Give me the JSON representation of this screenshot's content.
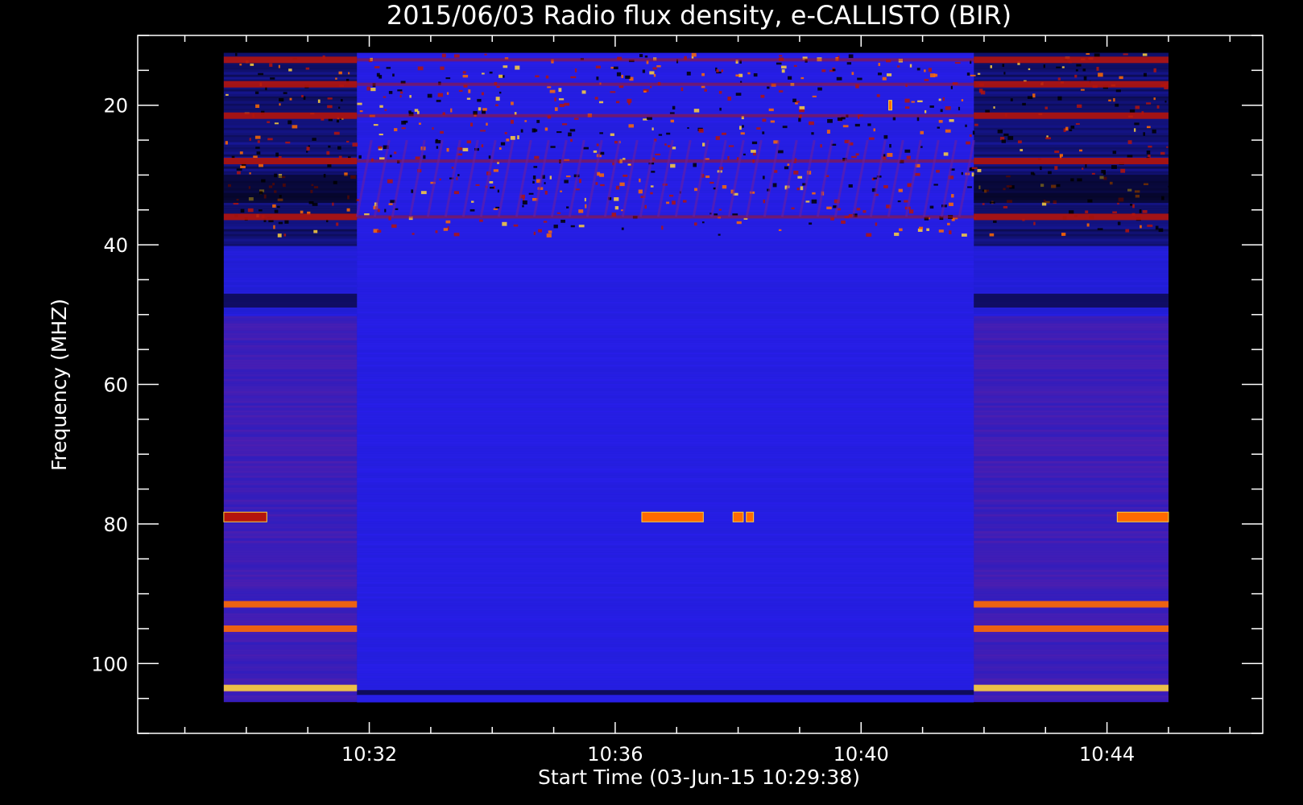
{
  "chart_data": {
    "type": "heatmap",
    "title": "2015/06/03  Radio flux density, e-CALLISTO (BIR)",
    "xlabel": "Start Time (03-Jun-15 10:29:38)",
    "ylabel": "Frequency (MHZ)",
    "x_start": "10:29:38",
    "x_end": "10:45:00",
    "x_axis_range": [
      "10:28:14",
      "10:46:32"
    ],
    "x_ticks": [
      "10:32",
      "10:36",
      "10:40",
      "10:44"
    ],
    "y_axis_range": [
      10,
      110
    ],
    "y_data_range": [
      12.5,
      105.5
    ],
    "y_reversed": true,
    "y_ticks": [
      20,
      40,
      60,
      80,
      100
    ],
    "colormap": [
      "#000000",
      "#1e1ec8",
      "#2a1ef0",
      "#6a1ea0",
      "#b4140c",
      "#ff6a00",
      "#ffd23c"
    ],
    "background_level": "blue",
    "quiet_segment": {
      "start": "10:31:48",
      "end": "10:41:50"
    },
    "bursts": [
      {
        "time_start": "10:36:26",
        "time_end": "10:37:26",
        "freq_mhz": 79,
        "intensity": "high"
      },
      {
        "time_start": "10:37:55",
        "time_end": "10:38:05",
        "freq_mhz": 79,
        "intensity": "high"
      },
      {
        "time_start": "10:38:08",
        "time_end": "10:38:15",
        "freq_mhz": 79,
        "intensity": "high"
      },
      {
        "time_start": "10:44:10",
        "time_end": "10:45:00",
        "freq_mhz": 79,
        "intensity": "high"
      },
      {
        "time_start": "10:29:38",
        "time_end": "10:30:20",
        "freq_mhz": 79,
        "intensity": "medium"
      },
      {
        "time_start": "10:40:27",
        "time_end": "10:40:30",
        "freq_mhz": 20,
        "intensity": "high"
      }
    ],
    "interference_bands_mhz": [
      13.5,
      17,
      21.5,
      28,
      36,
      91.5,
      95,
      103.5
    ],
    "grid": false,
    "legend": "none"
  }
}
